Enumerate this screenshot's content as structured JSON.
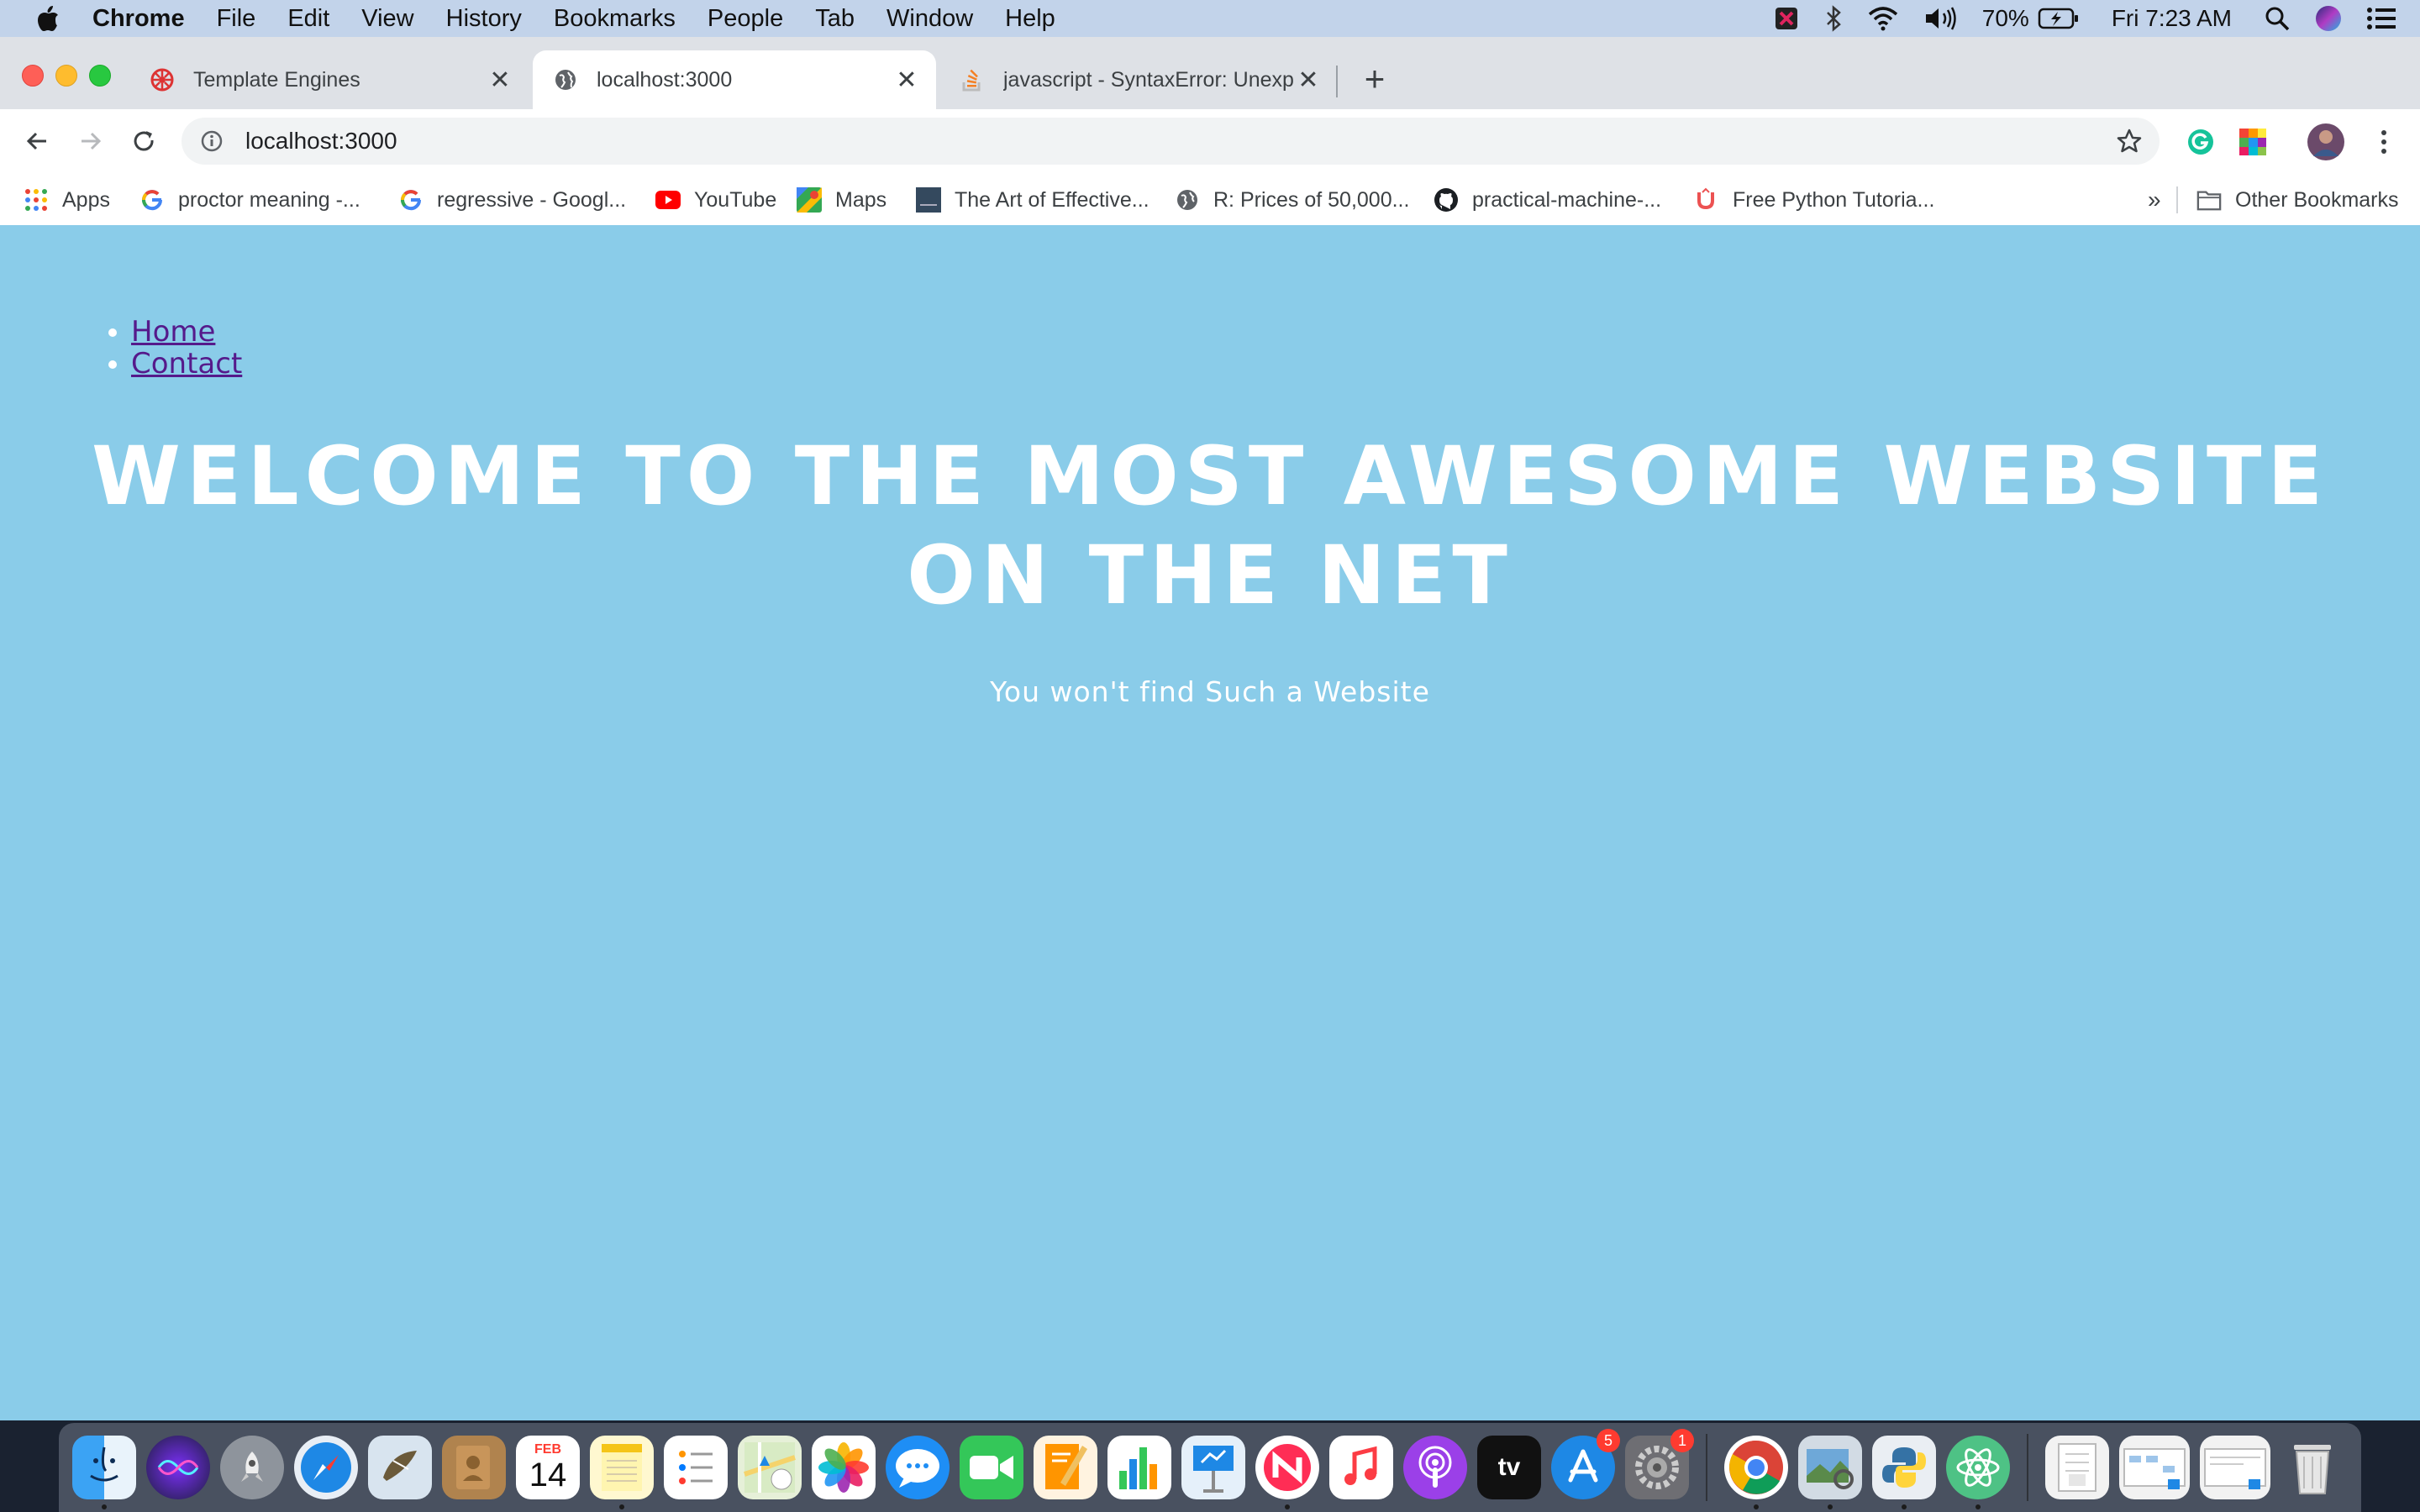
{
  "menubar": {
    "app_name": "Chrome",
    "items": [
      "File",
      "Edit",
      "View",
      "History",
      "Bookmarks",
      "People",
      "Tab",
      "Window",
      "Help"
    ],
    "battery": "70%",
    "clock": "Fri 7:23 AM"
  },
  "tabs": [
    {
      "title": "Template Engines",
      "icon": "angular-icon",
      "active": false
    },
    {
      "title": "localhost:3000",
      "icon": "globe-icon",
      "active": true
    },
    {
      "title": "javascript - SyntaxError: Unexpe",
      "icon": "stackoverflow-icon",
      "active": false
    }
  ],
  "omnibox": {
    "url": "localhost:3000"
  },
  "bookmarks": [
    {
      "label": "Apps",
      "icon": "apps-grid-icon"
    },
    {
      "label": "proctor meaning -...",
      "icon": "google-icon"
    },
    {
      "label": "regressive - Googl...",
      "icon": "google-icon"
    },
    {
      "label": "YouTube",
      "icon": "youtube-icon"
    },
    {
      "label": "Maps",
      "icon": "maps-icon"
    },
    {
      "label": "The Art of Effective...",
      "icon": "book-icon"
    },
    {
      "label": "R: Prices of 50,000...",
      "icon": "globe-icon"
    },
    {
      "label": "practical-machine-...",
      "icon": "github-icon"
    },
    {
      "label": "Free Python Tutoria...",
      "icon": "udemy-icon"
    }
  ],
  "bookmarks_overflow": "»",
  "other_bookmarks": "Other Bookmarks",
  "page": {
    "nav": [
      "Home",
      "Contact"
    ],
    "headline_line1": "WELCOME TO THE MOST AWESOME WEBSITE",
    "headline_line2": "ON THE NET",
    "subtitle": "You won't find Such a Website"
  },
  "dock": {
    "calendar_month": "FEB",
    "calendar_day": "14",
    "appstore_badge": "5",
    "prefs_badge": "1",
    "tv_label": "tv"
  },
  "colors": {
    "page_background": "#8acce9",
    "link": "#551a8b",
    "menubar": "#c2d3ea"
  }
}
